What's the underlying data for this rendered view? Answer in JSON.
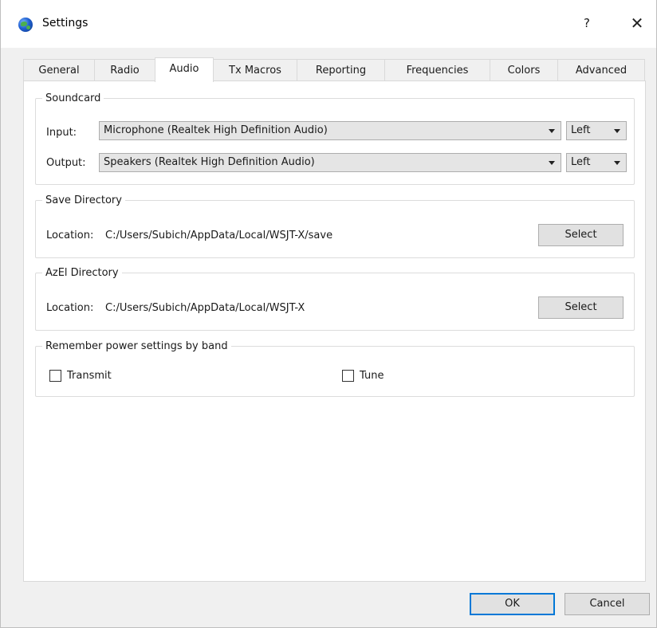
{
  "window": {
    "title": "Settings",
    "help_label": "?",
    "close_label": "✕"
  },
  "tabs": [
    {
      "label": "General"
    },
    {
      "label": "Radio"
    },
    {
      "label": "Audio",
      "active": true
    },
    {
      "label": "Tx Macros"
    },
    {
      "label": "Reporting"
    },
    {
      "label": "Frequencies"
    },
    {
      "label": "Colors"
    },
    {
      "label": "Advanced"
    }
  ],
  "soundcard": {
    "title": "Soundcard",
    "input_label": "Input:",
    "input_value": "Microphone (Realtek High Definition Audio)",
    "input_channel": "Left",
    "output_label": "Output:",
    "output_value": "Speakers (Realtek High Definition Audio)",
    "output_channel": "Left"
  },
  "save_directory": {
    "title": "Save Directory",
    "location_label": "Location:",
    "location_value": "C:/Users/Subich/AppData/Local/WSJT-X/save",
    "select_label": "Select"
  },
  "azel_directory": {
    "title": "AzEl Directory",
    "location_label": "Location:",
    "location_value": "C:/Users/Subich/AppData/Local/WSJT-X",
    "select_label": "Select"
  },
  "power": {
    "title": "Remember power settings by band",
    "transmit_label": "Transmit",
    "transmit_checked": false,
    "tune_label": "Tune",
    "tune_checked": false
  },
  "footer": {
    "ok_label": "OK",
    "cancel_label": "Cancel"
  }
}
